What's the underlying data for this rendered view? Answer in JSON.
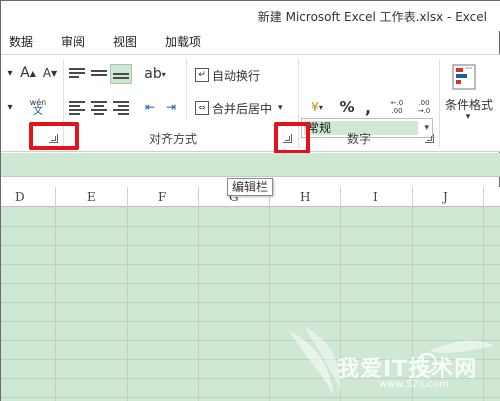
{
  "window": {
    "title": "新建 Microsoft Excel 工作表.xlsx - Excel"
  },
  "tabs": [
    "数据",
    "审阅",
    "视图",
    "加载项"
  ],
  "ribbon": {
    "font_grow_label": "A",
    "font_shrink_label": "A",
    "phonetic_label": "wén",
    "phonetic_sub": "文",
    "wrap_text_label": "自动换行",
    "merge_center_label": "合并后居中",
    "alignment_group_label": "对齐方式",
    "number_format_value": "常规",
    "percent_label": "%",
    "comma_label": ",",
    "inc_decimal_label": "←.0 .00",
    "dec_decimal_label": ".00 →.0",
    "number_group_label": "数字",
    "conditional_format_label": "条件格式"
  },
  "tooltip": {
    "text": "编辑栏"
  },
  "columns": [
    "D",
    "E",
    "F",
    "G",
    "H",
    "I",
    "J"
  ],
  "watermark": {
    "text": "我爱IT技术网",
    "url": "www.52ij.com"
  },
  "colors": {
    "grid_fill": "#cfe8d4",
    "highlight": "#e3121b",
    "accent_green": "#cfe8d4"
  }
}
